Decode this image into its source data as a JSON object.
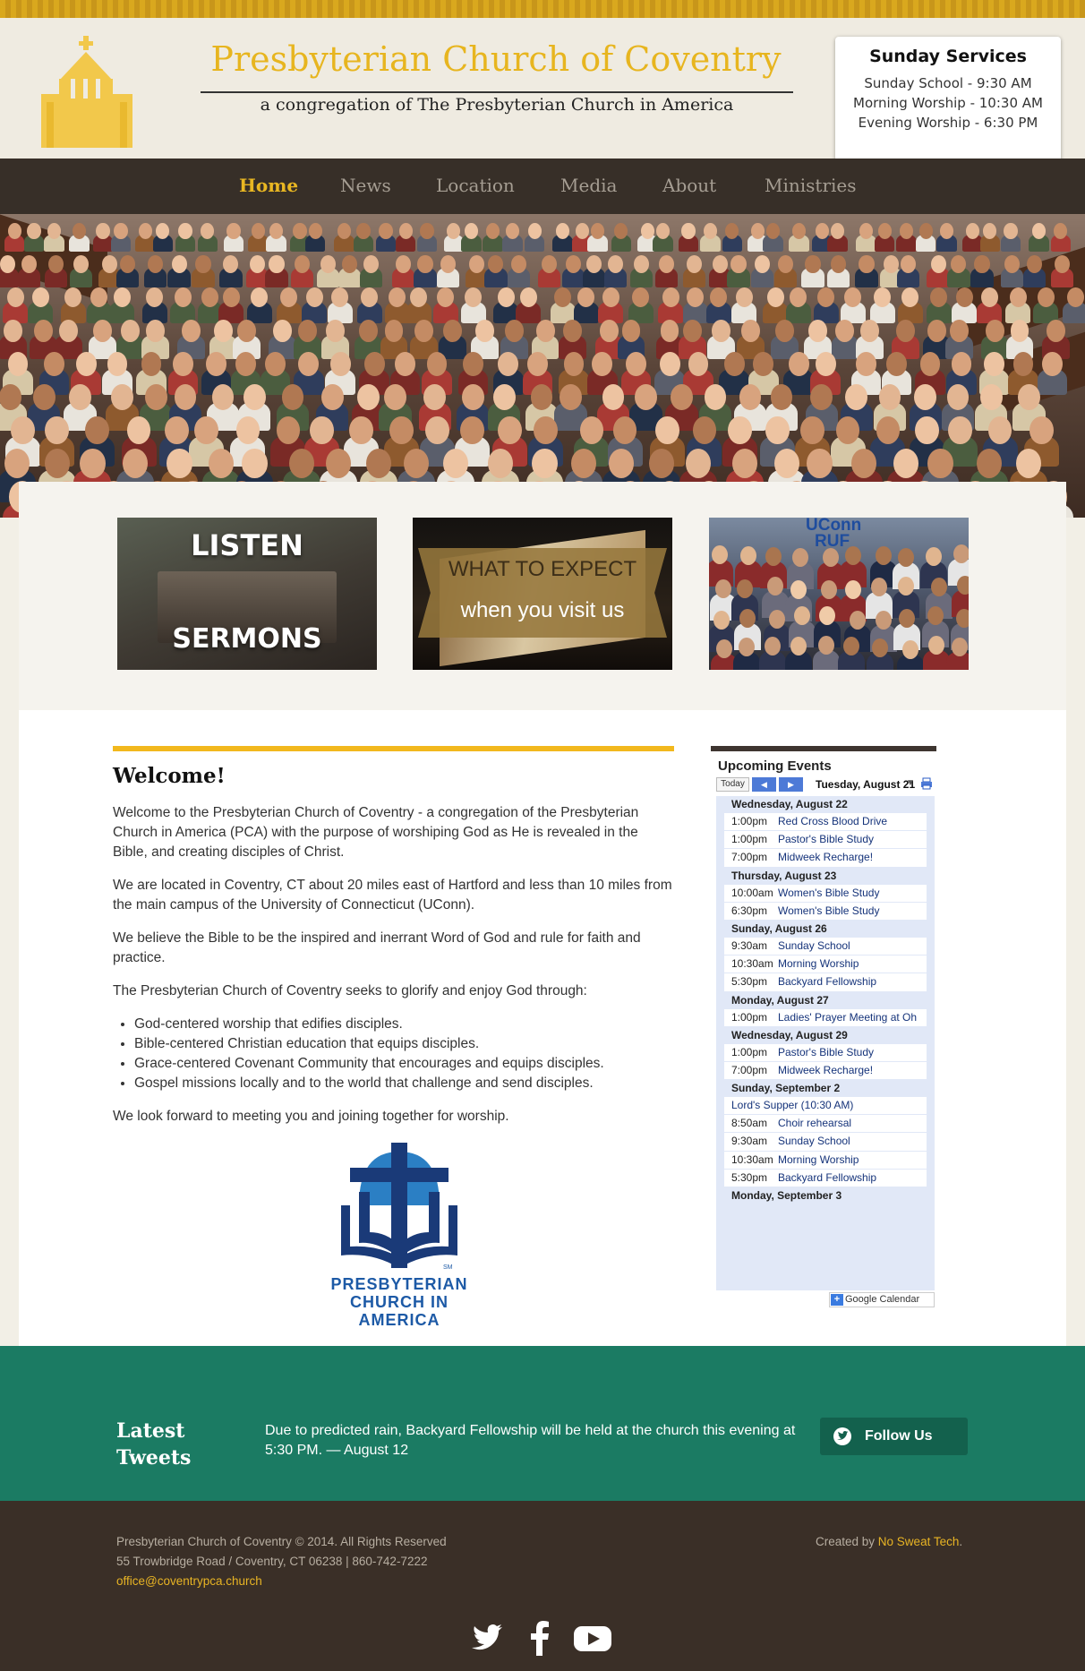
{
  "header": {
    "title": "Presbyterian Church of Coventry",
    "subtitle": "a congregation of The Presbyterian Church in America"
  },
  "services": {
    "title": "Sunday Services",
    "items": [
      "Sunday School - 9:30 AM",
      "Morning Worship - 10:30 AM",
      "Evening Worship - 6:30 PM"
    ]
  },
  "nav": {
    "items": [
      "Home",
      "News",
      "Location",
      "Media",
      "About",
      "Ministries"
    ],
    "active": "Home"
  },
  "features": {
    "listen_top": "LISTEN",
    "listen_bottom": "SERMONS",
    "expect_top": "WHAT TO EXPECT",
    "expect_bottom": "when you visit us",
    "ruf_line1": "UConn",
    "ruf_line2": "RUF"
  },
  "welcome": {
    "title": "Welcome!",
    "p1": "Welcome to the Presbyterian Church of Coventry - a congregation of the Presbyterian Church in America (PCA) with the purpose of worshiping God as He is revealed in the Bible, and creating disciples of Christ.",
    "p2": "We are located in Coventry, CT about 20 miles east of Hartford and less than 10 miles from the main campus of the University of Connecticut (UConn).",
    "p3": "We believe the Bible to be the inspired and inerrant Word of God and rule for faith and practice.",
    "p4": "The Presbyterian Church of Coventry seeks to glorify and enjoy God through:",
    "bullets": [
      "God-centered worship that edifies disciples.",
      "Bible-centered Christian education that equips disciples.",
      "Grace-centered Covenant Community that encourages and equips disciples.",
      "Gospel missions locally and to the world that challenge and send disciples."
    ],
    "p5": "We look forward to meeting you and joining together for worship."
  },
  "pca_logo": {
    "line1": "PRESBYTERIAN",
    "line2": "CHURCH IN",
    "line3": "AMERICA",
    "mark": "SM"
  },
  "calendar": {
    "title": "Upcoming Events",
    "today_label": "Today",
    "current_date": "Tuesday, August 21",
    "print_label": "P",
    "days": [
      {
        "label": "Wednesday, August 22",
        "events": [
          {
            "time": "1:00pm",
            "name": "Red Cross Blood Drive"
          },
          {
            "time": "1:00pm",
            "name": "Pastor's Bible Study"
          },
          {
            "time": "7:00pm",
            "name": "Midweek Recharge!"
          }
        ]
      },
      {
        "label": "Thursday, August 23",
        "events": [
          {
            "time": "10:00am",
            "name": "Women's Bible Study"
          },
          {
            "time": "6:30pm",
            "name": "Women's Bible Study"
          }
        ]
      },
      {
        "label": "Sunday, August 26",
        "events": [
          {
            "time": "9:30am",
            "name": "Sunday School"
          },
          {
            "time": "10:30am",
            "name": "Morning Worship"
          },
          {
            "time": "5:30pm",
            "name": "Backyard Fellowship"
          }
        ]
      },
      {
        "label": "Monday, August 27",
        "events": [
          {
            "time": "1:00pm",
            "name": "Ladies' Prayer Meeting at Oh"
          }
        ]
      },
      {
        "label": "Wednesday, August 29",
        "events": [
          {
            "time": "1:00pm",
            "name": "Pastor's Bible Study"
          },
          {
            "time": "7:00pm",
            "name": "Midweek Recharge!"
          }
        ]
      },
      {
        "label": "Sunday, September 2",
        "events": [
          {
            "time": "",
            "name": "Lord's Supper (10:30 AM)"
          },
          {
            "time": "8:50am",
            "name": "Choir rehearsal"
          },
          {
            "time": "9:30am",
            "name": "Sunday School"
          },
          {
            "time": "10:30am",
            "name": "Morning Worship"
          },
          {
            "time": "5:30pm",
            "name": "Backyard Fellowship"
          }
        ]
      },
      {
        "label": "Monday, September 3",
        "events": []
      }
    ],
    "footer_label": "Google Calendar"
  },
  "tweets": {
    "title_line1": "Latest",
    "title_line2": "Tweets",
    "text": "Due to predicted rain, Backyard Fellowship will be held at the church this evening at 5:30 PM. — August 12",
    "follow_label": "Follow Us"
  },
  "footer": {
    "copyright": "Presbyterian Church of Coventry © 2014. All Rights Reserved",
    "address": "55 Trowbridge Road / Coventry, CT 06238 | 860-742-7222",
    "email": "office@coventrypca.church",
    "credit_prefix": "Created by ",
    "credit_link": "No Sweat Tech",
    "credit_suffix": "."
  },
  "colors": {
    "gold": "#e7b51f",
    "nav_bg": "#372f28",
    "teal": "#1b7b63",
    "footer_bg": "#3a2f27",
    "pca_blue": "#1d5aa6"
  },
  "icons": [
    "church-logo-icon",
    "twitter-icon",
    "facebook-icon",
    "youtube-icon",
    "print-icon"
  ]
}
